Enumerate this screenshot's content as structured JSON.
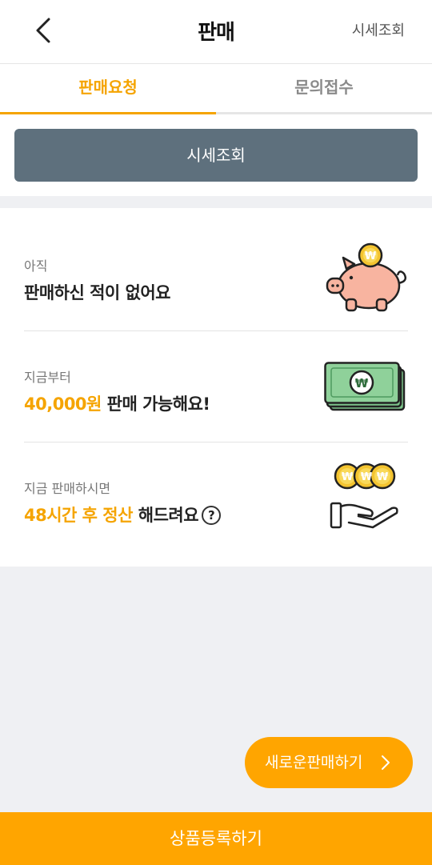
{
  "header": {
    "title": "판매",
    "action_label": "시세조회"
  },
  "tabs": [
    {
      "label": "판매요청",
      "active": true
    },
    {
      "label": "문의접수",
      "active": false
    }
  ],
  "price_check": {
    "button_label": "시세조회"
  },
  "info": {
    "rows": [
      {
        "caption": "아직",
        "headline": "판매하신 적이 없어요"
      },
      {
        "caption": "지금부터",
        "headline_highlight": "40,000원",
        "headline_rest": " 판매 가능해요!"
      },
      {
        "caption": "지금 판매하시면",
        "headline_highlight": "48시간 후 정산",
        "headline_rest": " 해드려요",
        "help_symbol": "?"
      }
    ]
  },
  "fab": {
    "label": "새로운판매하기"
  },
  "cta": {
    "label": "상품등록하기"
  },
  "icons": {
    "currency_symbol": "₩"
  },
  "colors": {
    "accent": "#ffa500",
    "tab_active": "#f5a400",
    "price_button": "#5e707d",
    "background": "#eff0f3"
  }
}
